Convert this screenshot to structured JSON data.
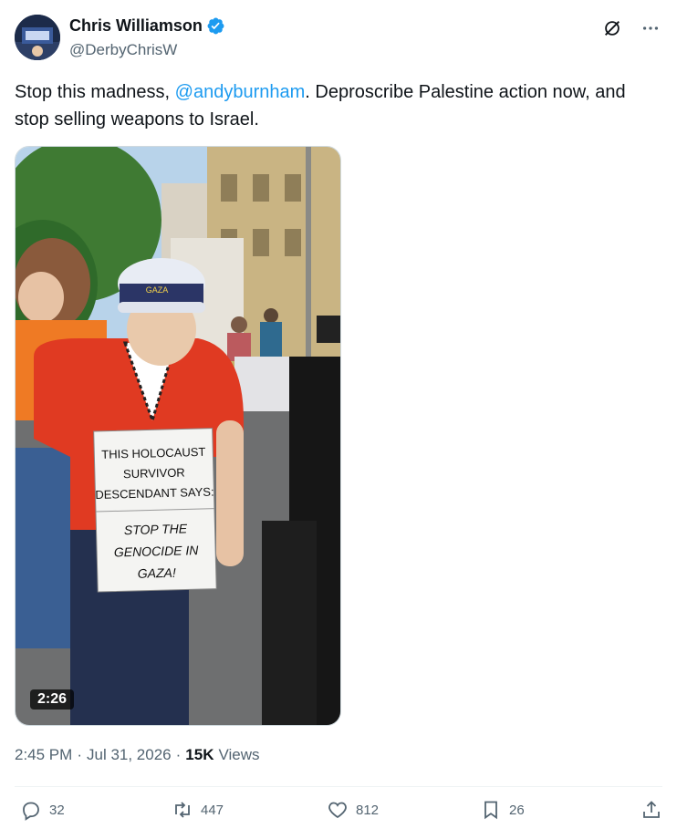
{
  "author": {
    "name": "Chris Williamson",
    "handle": "@DerbyChrisW"
  },
  "icons": {
    "verified": "verified-badge-icon",
    "grok": "grok-icon",
    "more": "more-icon",
    "reply": "reply-icon",
    "retweet": "retweet-icon",
    "like": "heart-icon",
    "bookmark": "bookmark-icon",
    "share": "share-icon"
  },
  "tweet": {
    "text_before": "Stop this madness, ",
    "mention": "@andyburnham",
    "text_after": ". Deproscribe Palestine action now, and stop selling weapons to Israel."
  },
  "media": {
    "duration": "2:26",
    "sign_top": [
      "THIS HOLOCAUST",
      "SURVIVOR",
      "DESCENDANT SAYS:"
    ],
    "sign_bottom": [
      "STOP THE",
      "GENOCIDE IN",
      "GAZA!"
    ],
    "cap_text": "GAZA"
  },
  "meta": {
    "time": "2:45 PM",
    "sep1": "·",
    "date": "Jul 31, 2026",
    "sep2": "·",
    "views_count": "15K",
    "views_label": "Views"
  },
  "actions": {
    "replies": "32",
    "retweets": "447",
    "likes": "812",
    "bookmarks": "26"
  },
  "colors": {
    "accent": "#1d9bf0",
    "text": "#0f1419",
    "secondary": "#536471"
  }
}
